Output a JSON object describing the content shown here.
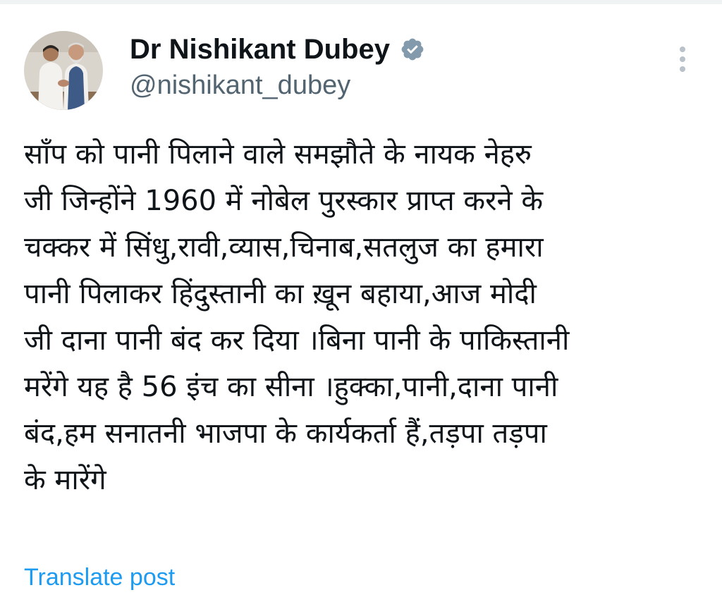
{
  "author": {
    "display_name": "Dr Nishikant Dubey",
    "handle": "@nishikant_dubey",
    "verified": true,
    "verified_badge_color": "#829aab",
    "avatar_icon": "profile-photo"
  },
  "tweet": {
    "lines": [
      "साँप को पानी पिलाने वाले समझौते के नायक नेहरु",
      "जी जिन्होंने 1960 में नोबेल पुरस्कार प्राप्त करने के",
      "चक्कर में सिंधु,रावी,व्यास,चिनाब,सतलुज का हमारा",
      "पानी पिलाकर हिंदुस्तानी का ख़ून बहाया,आज मोदी",
      "जी दाना पानी बंद कर दिया ।बिना पानी के पाकिस्तानी",
      "मरेंगे यह है 56 इंच का सीना ।हुक्का,पानी,दाना पानी",
      "बंद,हम सनातनी भाजपा के कार्यकर्ता हैं,तड़पा तड़पा",
      "के मारेंगे"
    ]
  },
  "actions": {
    "translate_label": "Translate post",
    "more_icon": "more-vertical-icon"
  },
  "colors": {
    "text_primary": "#0f1419",
    "text_secondary": "#536471",
    "link": "#1d9bf0",
    "icon_muted": "#b9c2c9"
  }
}
